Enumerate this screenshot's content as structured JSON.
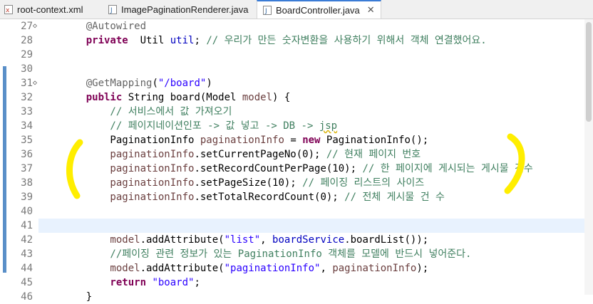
{
  "tabs": [
    {
      "label": "root-context.xml",
      "icon": "xml-file-icon",
      "active": false
    },
    {
      "label": "ImagePaginationRenderer.java",
      "icon": "java-file-icon",
      "active": false
    },
    {
      "label": "BoardController.java",
      "icon": "java-file-icon",
      "active": true,
      "close": "✕"
    }
  ],
  "lines": [
    {
      "num": "27",
      "parts": [
        [
          "an",
          "    @Autowired"
        ]
      ],
      "fold": "◇"
    },
    {
      "num": "28",
      "parts": [
        [
          "kw",
          "    private"
        ],
        [
          "",
          "  Util "
        ],
        [
          "fd",
          "util"
        ],
        [
          "",
          "; "
        ],
        [
          "cm",
          "// 우리가 만든 숫자변환을 사용하기 위해서 객체 연결했어요."
        ]
      ]
    },
    {
      "num": "29",
      "parts": []
    },
    {
      "num": "30",
      "parts": []
    },
    {
      "num": "31",
      "parts": [
        [
          "an",
          "    @GetMapping"
        ],
        [
          "",
          "("
        ],
        [
          "st",
          "\"/board\""
        ],
        [
          "",
          ")"
        ]
      ],
      "fold": "◇"
    },
    {
      "num": "32",
      "parts": [
        [
          "kw",
          "    public"
        ],
        [
          "",
          " String board(Model "
        ],
        [
          "vr",
          "model"
        ],
        [
          "",
          ") {"
        ]
      ]
    },
    {
      "num": "33",
      "parts": [
        [
          "cm",
          "        // 서비스에서 값 가져오기"
        ]
      ]
    },
    {
      "num": "34",
      "parts": [
        [
          "cm",
          "        // 페이지네이션인포 -> 값 넣고 -> DB -> "
        ],
        [
          "cm squig",
          "jsp"
        ]
      ]
    },
    {
      "num": "35",
      "parts": [
        [
          "",
          "        PaginationInfo "
        ],
        [
          "vr",
          "paginationInfo"
        ],
        [
          "",
          " = "
        ],
        [
          "kw",
          "new"
        ],
        [
          "",
          " PaginationInfo();"
        ]
      ]
    },
    {
      "num": "36",
      "parts": [
        [
          "vr",
          "        paginationInfo"
        ],
        [
          "",
          ".setCurrentPageNo(0); "
        ],
        [
          "cm",
          "// 현재 페이지 번호"
        ]
      ]
    },
    {
      "num": "37",
      "parts": [
        [
          "vr",
          "        paginationInfo"
        ],
        [
          "",
          ".setRecordCountPerPage(10); "
        ],
        [
          "cm",
          "// 한 페이지에 게시되는 게시물 건수"
        ]
      ]
    },
    {
      "num": "38",
      "parts": [
        [
          "vr",
          "        paginationInfo"
        ],
        [
          "",
          ".setPageSize(10); "
        ],
        [
          "cm",
          "// 페이징 리스트의 사이즈"
        ]
      ]
    },
    {
      "num": "39",
      "parts": [
        [
          "vr",
          "        paginationInfo"
        ],
        [
          "",
          ".setTotalRecordCount(0); "
        ],
        [
          "cm",
          "// 전체 게시물 건 수"
        ]
      ]
    },
    {
      "num": "40",
      "parts": []
    },
    {
      "num": "41",
      "parts": [],
      "current": true
    },
    {
      "num": "42",
      "parts": [
        [
          "vr",
          "        model"
        ],
        [
          "",
          ".addAttribute("
        ],
        [
          "st",
          "\"list\""
        ],
        [
          "",
          ", "
        ],
        [
          "fd",
          "boardService"
        ],
        [
          "",
          ".boardList());"
        ]
      ]
    },
    {
      "num": "43",
      "parts": [
        [
          "cm",
          "        //페이징 관련 정보가 있는 PaginationInfo 객체를 모델에 반드시 넣어준다."
        ]
      ]
    },
    {
      "num": "44",
      "parts": [
        [
          "vr",
          "        model"
        ],
        [
          "",
          ".addAttribute("
        ],
        [
          "st",
          "\"paginationInfo\""
        ],
        [
          "",
          ", "
        ],
        [
          "vr",
          "paginationInfo"
        ],
        [
          "",
          ");"
        ]
      ]
    },
    {
      "num": "45",
      "parts": [
        [
          "kw",
          "        return"
        ],
        [
          "",
          " "
        ],
        [
          "st",
          "\"board\""
        ],
        [
          ";",
          ";"
        ]
      ]
    },
    {
      "num": "46",
      "parts": [
        [
          "",
          "    }"
        ]
      ]
    }
  ],
  "colors": {
    "keyword": "#7f0055",
    "comment": "#3f7f5f",
    "string": "#2a00ff",
    "field": "#0000c0",
    "annotation": "#646464",
    "highlight_marker": "#ffee00"
  }
}
